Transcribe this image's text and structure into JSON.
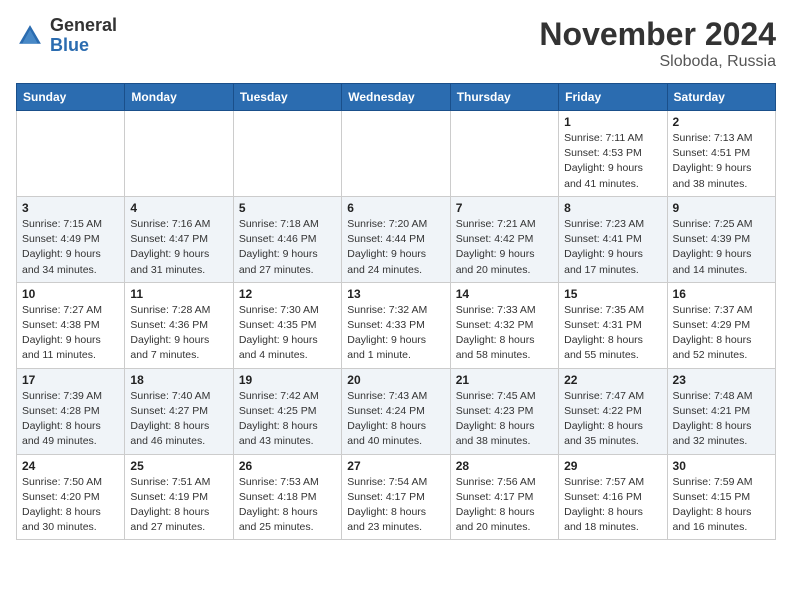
{
  "header": {
    "logo_general": "General",
    "logo_blue": "Blue",
    "month_title": "November 2024",
    "location": "Sloboda, Russia"
  },
  "days_of_week": [
    "Sunday",
    "Monday",
    "Tuesday",
    "Wednesday",
    "Thursday",
    "Friday",
    "Saturday"
  ],
  "weeks": [
    [
      {
        "day": "",
        "info": ""
      },
      {
        "day": "",
        "info": ""
      },
      {
        "day": "",
        "info": ""
      },
      {
        "day": "",
        "info": ""
      },
      {
        "day": "",
        "info": ""
      },
      {
        "day": "1",
        "info": "Sunrise: 7:11 AM\nSunset: 4:53 PM\nDaylight: 9 hours\nand 41 minutes."
      },
      {
        "day": "2",
        "info": "Sunrise: 7:13 AM\nSunset: 4:51 PM\nDaylight: 9 hours\nand 38 minutes."
      }
    ],
    [
      {
        "day": "3",
        "info": "Sunrise: 7:15 AM\nSunset: 4:49 PM\nDaylight: 9 hours\nand 34 minutes."
      },
      {
        "day": "4",
        "info": "Sunrise: 7:16 AM\nSunset: 4:47 PM\nDaylight: 9 hours\nand 31 minutes."
      },
      {
        "day": "5",
        "info": "Sunrise: 7:18 AM\nSunset: 4:46 PM\nDaylight: 9 hours\nand 27 minutes."
      },
      {
        "day": "6",
        "info": "Sunrise: 7:20 AM\nSunset: 4:44 PM\nDaylight: 9 hours\nand 24 minutes."
      },
      {
        "day": "7",
        "info": "Sunrise: 7:21 AM\nSunset: 4:42 PM\nDaylight: 9 hours\nand 20 minutes."
      },
      {
        "day": "8",
        "info": "Sunrise: 7:23 AM\nSunset: 4:41 PM\nDaylight: 9 hours\nand 17 minutes."
      },
      {
        "day": "9",
        "info": "Sunrise: 7:25 AM\nSunset: 4:39 PM\nDaylight: 9 hours\nand 14 minutes."
      }
    ],
    [
      {
        "day": "10",
        "info": "Sunrise: 7:27 AM\nSunset: 4:38 PM\nDaylight: 9 hours\nand 11 minutes."
      },
      {
        "day": "11",
        "info": "Sunrise: 7:28 AM\nSunset: 4:36 PM\nDaylight: 9 hours\nand 7 minutes."
      },
      {
        "day": "12",
        "info": "Sunrise: 7:30 AM\nSunset: 4:35 PM\nDaylight: 9 hours\nand 4 minutes."
      },
      {
        "day": "13",
        "info": "Sunrise: 7:32 AM\nSunset: 4:33 PM\nDaylight: 9 hours\nand 1 minute."
      },
      {
        "day": "14",
        "info": "Sunrise: 7:33 AM\nSunset: 4:32 PM\nDaylight: 8 hours\nand 58 minutes."
      },
      {
        "day": "15",
        "info": "Sunrise: 7:35 AM\nSunset: 4:31 PM\nDaylight: 8 hours\nand 55 minutes."
      },
      {
        "day": "16",
        "info": "Sunrise: 7:37 AM\nSunset: 4:29 PM\nDaylight: 8 hours\nand 52 minutes."
      }
    ],
    [
      {
        "day": "17",
        "info": "Sunrise: 7:39 AM\nSunset: 4:28 PM\nDaylight: 8 hours\nand 49 minutes."
      },
      {
        "day": "18",
        "info": "Sunrise: 7:40 AM\nSunset: 4:27 PM\nDaylight: 8 hours\nand 46 minutes."
      },
      {
        "day": "19",
        "info": "Sunrise: 7:42 AM\nSunset: 4:25 PM\nDaylight: 8 hours\nand 43 minutes."
      },
      {
        "day": "20",
        "info": "Sunrise: 7:43 AM\nSunset: 4:24 PM\nDaylight: 8 hours\nand 40 minutes."
      },
      {
        "day": "21",
        "info": "Sunrise: 7:45 AM\nSunset: 4:23 PM\nDaylight: 8 hours\nand 38 minutes."
      },
      {
        "day": "22",
        "info": "Sunrise: 7:47 AM\nSunset: 4:22 PM\nDaylight: 8 hours\nand 35 minutes."
      },
      {
        "day": "23",
        "info": "Sunrise: 7:48 AM\nSunset: 4:21 PM\nDaylight: 8 hours\nand 32 minutes."
      }
    ],
    [
      {
        "day": "24",
        "info": "Sunrise: 7:50 AM\nSunset: 4:20 PM\nDaylight: 8 hours\nand 30 minutes."
      },
      {
        "day": "25",
        "info": "Sunrise: 7:51 AM\nSunset: 4:19 PM\nDaylight: 8 hours\nand 27 minutes."
      },
      {
        "day": "26",
        "info": "Sunrise: 7:53 AM\nSunset: 4:18 PM\nDaylight: 8 hours\nand 25 minutes."
      },
      {
        "day": "27",
        "info": "Sunrise: 7:54 AM\nSunset: 4:17 PM\nDaylight: 8 hours\nand 23 minutes."
      },
      {
        "day": "28",
        "info": "Sunrise: 7:56 AM\nSunset: 4:17 PM\nDaylight: 8 hours\nand 20 minutes."
      },
      {
        "day": "29",
        "info": "Sunrise: 7:57 AM\nSunset: 4:16 PM\nDaylight: 8 hours\nand 18 minutes."
      },
      {
        "day": "30",
        "info": "Sunrise: 7:59 AM\nSunset: 4:15 PM\nDaylight: 8 hours\nand 16 minutes."
      }
    ]
  ]
}
